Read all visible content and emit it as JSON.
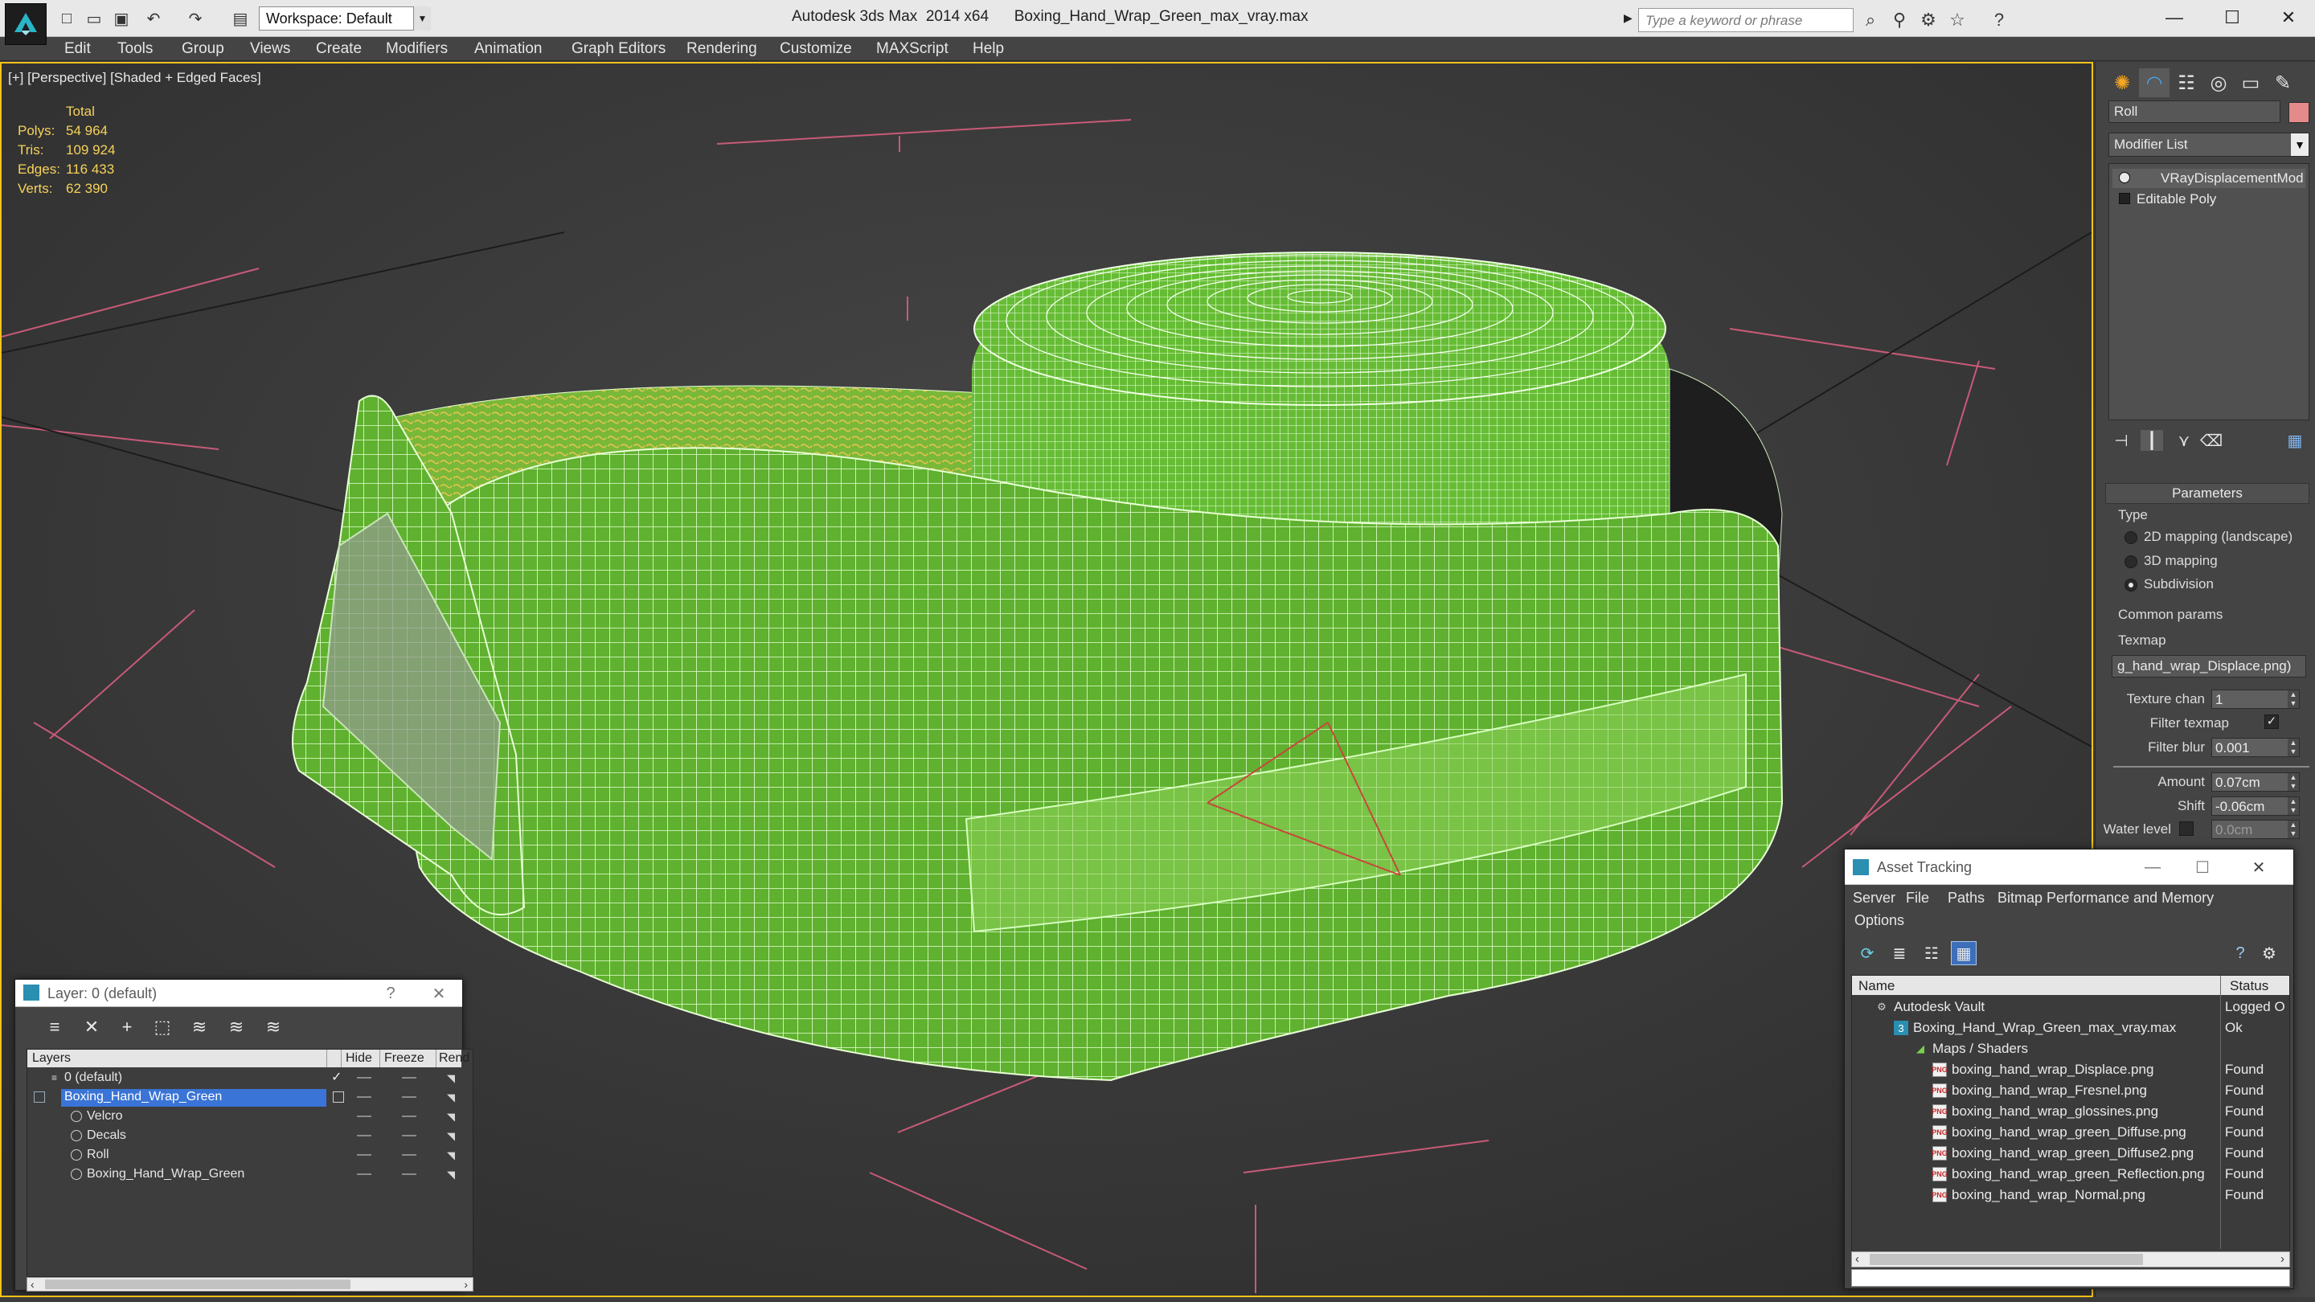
{
  "titlebar": {
    "workspace": "Workspace: Default",
    "title": "Autodesk 3ds Max  2014 x64      Boxing_Hand_Wrap_Green_max_vray.max",
    "search_placeholder": "Type a keyword or phrase"
  },
  "menu": [
    "Edit",
    "Tools",
    "Group",
    "Views",
    "Create",
    "Modifiers",
    "Animation",
    "Graph Editors",
    "Rendering",
    "Customize",
    "MAXScript",
    "Help"
  ],
  "viewport": {
    "label": "[+] [Perspective] [Shaded + Edged Faces]",
    "stats_header": "Total",
    "stats": [
      {
        "key": "Polys:",
        "value": "54 964"
      },
      {
        "key": "Tris:",
        "value": "109 924"
      },
      {
        "key": "Edges:",
        "value": "116 433"
      },
      {
        "key": "Verts:",
        "value": "62 390"
      }
    ],
    "colors": {
      "mesh": "#6bc234",
      "wire": "#e8ffd8",
      "grid": "#c85a78"
    }
  },
  "command_panel": {
    "object_name": "Roll",
    "object_color": "#e58a8a",
    "modifier_list": "Modifier List",
    "stack": [
      "VRayDisplacementMod",
      "Editable Poly"
    ],
    "rollout_title": "Parameters",
    "type_group": "Type",
    "type_options": [
      "2D mapping (landscape)",
      "3D mapping",
      "Subdivision"
    ],
    "selected_type": "Subdivision",
    "common_group": "Common params",
    "texmap_label": "Texmap",
    "texmap_value": "g_hand_wrap_Displace.png)",
    "texture_chan_label": "Texture chan",
    "texture_chan_value": "1",
    "filter_texmap_label": "Filter texmap",
    "filter_texmap_checked": true,
    "filter_blur_label": "Filter blur",
    "filter_blur_value": "0.001",
    "amount_label": "Amount",
    "amount_value": "0.07cm",
    "shift_label": "Shift",
    "shift_value": "-0.06cm",
    "water_label": "Water level",
    "water_value": "0.0cm"
  },
  "layer_dialog": {
    "title": "Layer: 0 (default)",
    "columns": [
      "Layers",
      "Hide",
      "Freeze",
      "Rend"
    ],
    "rows": [
      {
        "name": "0 (default)",
        "level": 0,
        "selected": false
      },
      {
        "name": "Boxing_Hand_Wrap_Green",
        "level": 0,
        "selected": true
      },
      {
        "name": "Velcro",
        "level": 1,
        "selected": false
      },
      {
        "name": "Decals",
        "level": 1,
        "selected": false
      },
      {
        "name": "Roll",
        "level": 1,
        "selected": false
      },
      {
        "name": "Boxing_Hand_Wrap_Green",
        "level": 1,
        "selected": false
      }
    ]
  },
  "asset_dialog": {
    "title": "Asset Tracking",
    "menu": [
      "Server",
      "File",
      "Paths",
      "Bitmap Performance and Memory"
    ],
    "menu2": "Options",
    "columns": [
      "Name",
      "Status"
    ],
    "rows": [
      {
        "name": "Autodesk Vault",
        "status": "Logged O",
        "indent": 0,
        "icon": "vault-icon"
      },
      {
        "name": "Boxing_Hand_Wrap_Green_max_vray.max",
        "status": "Ok",
        "indent": 1,
        "icon": "max-file-icon"
      },
      {
        "name": "Maps / Shaders",
        "status": "",
        "indent": 2,
        "icon": "maps-icon"
      },
      {
        "name": "boxing_hand_wrap_Displace.png",
        "status": "Found",
        "indent": 3,
        "icon": "png-icon"
      },
      {
        "name": "boxing_hand_wrap_Fresnel.png",
        "status": "Found",
        "indent": 3,
        "icon": "png-icon"
      },
      {
        "name": "boxing_hand_wrap_glossines.png",
        "status": "Found",
        "indent": 3,
        "icon": "png-icon"
      },
      {
        "name": "boxing_hand_wrap_green_Diffuse.png",
        "status": "Found",
        "indent": 3,
        "icon": "png-icon"
      },
      {
        "name": "boxing_hand_wrap_green_Diffuse2.png",
        "status": "Found",
        "indent": 3,
        "icon": "png-icon"
      },
      {
        "name": "boxing_hand_wrap_green_Reflection.png",
        "status": "Found",
        "indent": 3,
        "icon": "png-icon"
      },
      {
        "name": "boxing_hand_wrap_Normal.png",
        "status": "Found",
        "indent": 3,
        "icon": "png-icon"
      }
    ]
  }
}
